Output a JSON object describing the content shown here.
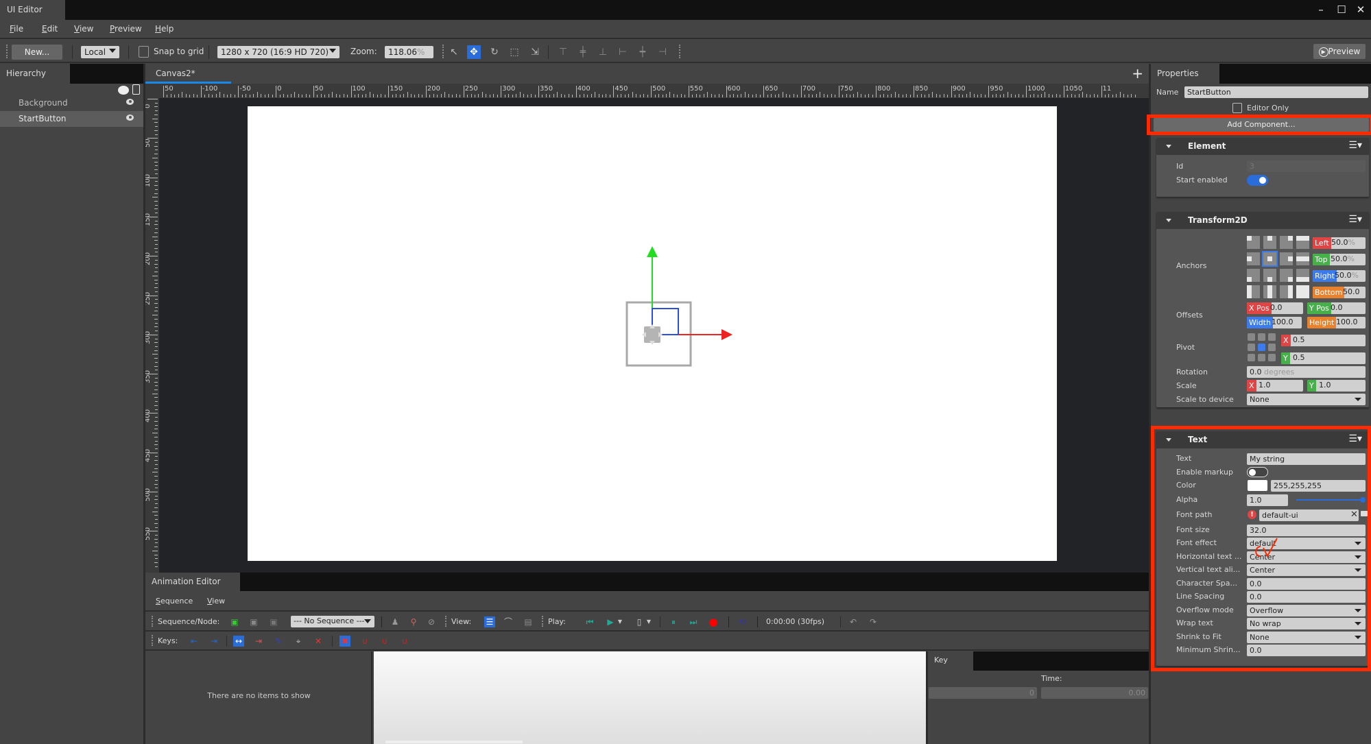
{
  "window": {
    "title": "UI Editor",
    "controls": {
      "minimize": "–",
      "maximize": "☐",
      "close": "✕"
    }
  },
  "menu": [
    {
      "label": "File",
      "mnemonic": "F",
      "rest": "ile"
    },
    {
      "label": "Edit",
      "mnemonic": "E",
      "rest": "dit"
    },
    {
      "label": "View",
      "mnemonic": "V",
      "rest": "iew"
    },
    {
      "label": "Preview",
      "mnemonic": "P",
      "rest": "review"
    },
    {
      "label": "Help",
      "mnemonic": "H",
      "rest": "elp"
    }
  ],
  "toolbar": {
    "new_label": "New...",
    "space": "Local",
    "snap_label": "Snap to grid",
    "snap_checked": false,
    "resolution": "1280 x 720 (16:9 HD 720)",
    "zoom_label": "Zoom:",
    "zoom_value": "118.06",
    "zoom_unit": "%",
    "tools": [
      {
        "name": "select-tool-icon",
        "glyph": "↖",
        "active": false
      },
      {
        "name": "move-tool-icon",
        "glyph": "✥",
        "active": true
      },
      {
        "name": "rotate-tool-icon",
        "glyph": "↻",
        "active": false
      },
      {
        "name": "scale-tool-icon",
        "glyph": "⬚",
        "active": false
      },
      {
        "name": "resize-tool-icon",
        "glyph": "⇲",
        "active": false
      }
    ],
    "align": [
      {
        "name": "align-top-icon",
        "glyph": "⊤"
      },
      {
        "name": "align-vcenter-icon",
        "glyph": "╪"
      },
      {
        "name": "align-bottom-icon",
        "glyph": "⊥"
      },
      {
        "name": "align-left-icon",
        "glyph": "⊢"
      },
      {
        "name": "align-hcenter-icon",
        "glyph": "┿"
      },
      {
        "name": "align-right-icon",
        "glyph": "⊣"
      }
    ],
    "preview_label": "Preview"
  },
  "hierarchy": {
    "title": "Hierarchy",
    "items": [
      {
        "label": "Background",
        "selected": false
      },
      {
        "label": "StartButton",
        "selected": true
      }
    ]
  },
  "canvas": {
    "tab": "Canvas2*",
    "hruler_labels": [
      "50",
      "-100",
      "-50",
      "0",
      "50",
      "100",
      "150",
      "200",
      "250",
      "300",
      "350",
      "400",
      "450",
      "500",
      "550",
      "600",
      "650",
      "700",
      "750",
      "800",
      "850",
      "900",
      "950",
      "1000",
      "1050",
      "11"
    ],
    "vruler_labels": [
      "0",
      "50",
      "100",
      "150",
      "200",
      "250",
      "300",
      "350",
      "400",
      "450",
      "500",
      "550"
    ]
  },
  "properties": {
    "title": "Properties",
    "name_label": "Name",
    "name_value": "StartButton",
    "editor_only_label": "Editor Only",
    "editor_only_checked": false,
    "add_component_label": "Add Component...",
    "element": {
      "title": "Element",
      "id_label": "Id",
      "id_value": "3",
      "start_enabled_label": "Start enabled",
      "start_enabled": true
    },
    "transform": {
      "title": "Transform2D",
      "anchors_label": "Anchors",
      "left_tag": "Left",
      "left_value": "50.0",
      "left_unit": "%",
      "top_tag": "Top",
      "top_value": "50.0",
      "top_unit": "%",
      "right_tag": "Right",
      "right_value": "50.0",
      "right_unit": "%",
      "bottom_tag": "Bottom",
      "bottom_value": "50.0",
      "bottom_unit": "%",
      "offsets_label": "Offsets",
      "xpos_tag": "X Pos",
      "xpos_value": "0.0",
      "ypos_tag": "Y Pos",
      "ypos_value": "0.0",
      "width_tag": "Width",
      "width_value": "100.0",
      "height_tag": "Height",
      "height_value": "100.0",
      "pivot_label": "Pivot",
      "pivot_x_tag": "X",
      "pivot_x": "0.5",
      "pivot_y_tag": "Y",
      "pivot_y": "0.5",
      "rotation_label": "Rotation",
      "rotation_value": "0.0",
      "rotation_unit": "degrees",
      "scale_label": "Scale",
      "scale_x_tag": "X",
      "scale_x": "1.0",
      "scale_y_tag": "Y",
      "scale_y": "1.0",
      "scale_device_label": "Scale to device",
      "scale_device_value": "None"
    },
    "text": {
      "title": "Text",
      "rows": [
        {
          "label": "Text",
          "value": "My string",
          "kind": "input"
        },
        {
          "label": "Enable markup",
          "value": false,
          "kind": "toggle"
        },
        {
          "label": "Color",
          "value": "255,255,255",
          "kind": "color",
          "swatch": "#ffffff"
        },
        {
          "label": "Alpha",
          "value": "1.0",
          "kind": "slider",
          "fraction": 1.0
        },
        {
          "label": "Font path",
          "value": "default-ui",
          "kind": "path"
        },
        {
          "label": "Font size",
          "value": "32.0",
          "kind": "input"
        },
        {
          "label": "Font effect",
          "value": "default",
          "kind": "select"
        },
        {
          "label": "Horizontal text ...",
          "value": "Center",
          "kind": "select"
        },
        {
          "label": "Vertical text ali...",
          "value": "Center",
          "kind": "select"
        },
        {
          "label": "Character Spa...",
          "value": "0.0",
          "kind": "input"
        },
        {
          "label": "Line Spacing",
          "value": "0.0",
          "kind": "input"
        },
        {
          "label": "Overflow mode",
          "value": "Overflow",
          "kind": "select"
        },
        {
          "label": "Wrap text",
          "value": "No wrap",
          "kind": "select"
        },
        {
          "label": "Shrink to Fit",
          "value": "None",
          "kind": "select"
        },
        {
          "label": "Minimum Shrin...",
          "value": "0.0",
          "kind": "input"
        }
      ]
    }
  },
  "animation": {
    "title": "Animation Editor",
    "menu": [
      {
        "mnemonic": "S",
        "rest": "equence"
      },
      {
        "mnemonic": "V",
        "rest": "iew"
      }
    ],
    "seq_label": "Sequence/Node:",
    "sequence_value": "--- No Sequence ---",
    "view_label": "View:",
    "play_label": "Play:",
    "time_display": "0:00:00 (30fps)",
    "keys_label": "Keys:",
    "empty_message": "There are no items to show",
    "key_panel": {
      "title": "Key",
      "time_label": "Time:",
      "key_value": "0",
      "time_value": "0.00"
    }
  },
  "annotations": {
    "highlight_color": "#ff2a00",
    "scribble": "cv"
  }
}
